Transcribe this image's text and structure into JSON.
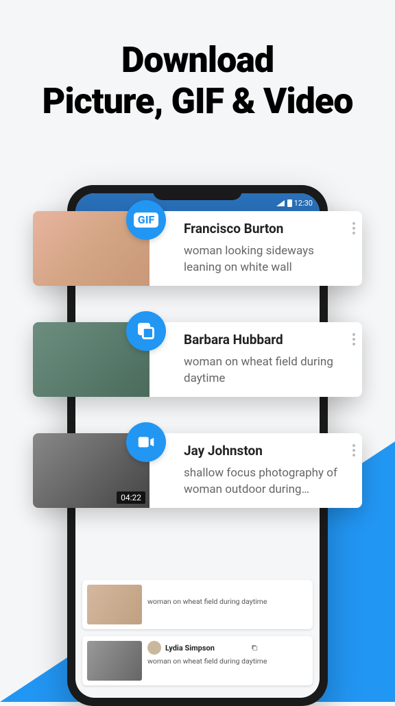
{
  "heading": {
    "line1": "Download",
    "line2": "Picture, GIF & Video"
  },
  "status": {
    "time": "12:30"
  },
  "float_cards": [
    {
      "name": "Francisco Burton",
      "desc": "woman looking sideways leaning on white wall",
      "badge": "gif"
    },
    {
      "name": "Barbara Hubbard",
      "desc": "woman on wheat field during daytime",
      "badge": "stack"
    },
    {
      "name": "Jay Johnston",
      "desc": "shallow focus photography of woman outdoor during…",
      "badge": "video",
      "duration": "04:22"
    }
  ],
  "bg_cards": [
    {
      "name": "",
      "desc": "woman on wheat field during daytime"
    },
    {
      "name": "Lydia Simpson",
      "desc": "woman on wheat field during daytime"
    }
  ]
}
